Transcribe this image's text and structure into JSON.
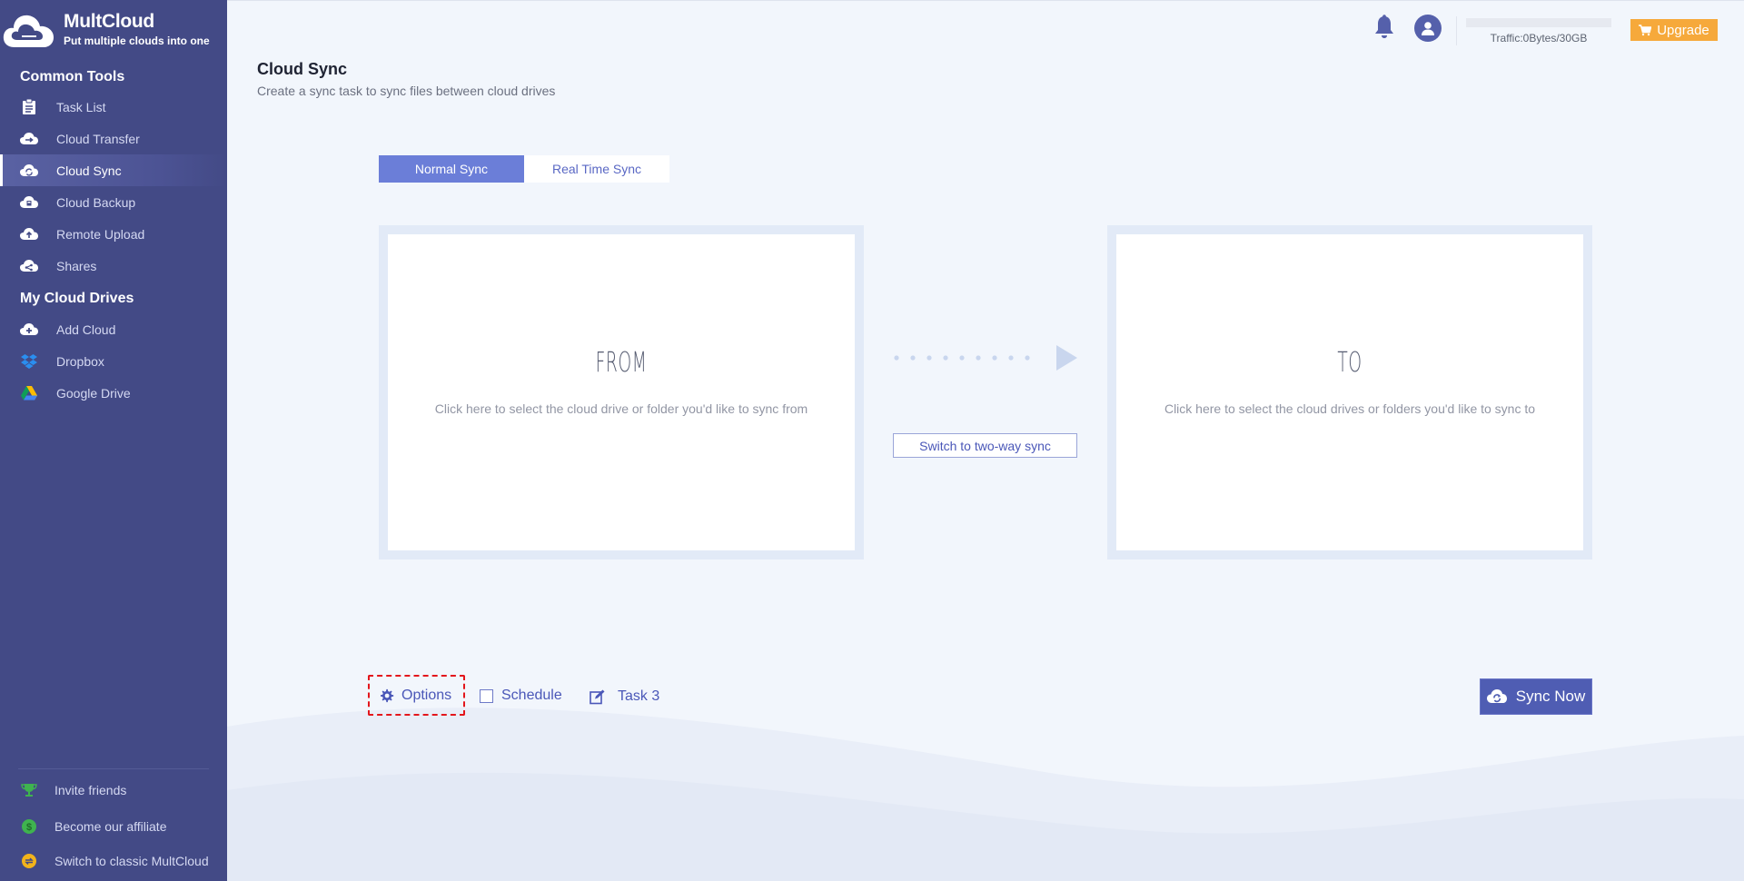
{
  "app": {
    "name": "MultCloud",
    "tagline": "Put multiple clouds into one"
  },
  "sidebar": {
    "common_tools_title": "Common Tools",
    "common_tools": [
      {
        "label": "Task List",
        "icon": "task-list-icon"
      },
      {
        "label": "Cloud Transfer",
        "icon": "cloud-transfer-icon"
      },
      {
        "label": "Cloud Sync",
        "icon": "cloud-sync-icon",
        "active": true
      },
      {
        "label": "Cloud Backup",
        "icon": "cloud-backup-icon"
      },
      {
        "label": "Remote Upload",
        "icon": "remote-upload-icon"
      },
      {
        "label": "Shares",
        "icon": "share-icon"
      }
    ],
    "my_cloud_drives_title": "My Cloud Drives",
    "my_cloud_drives": [
      {
        "label": "Add Cloud",
        "icon": "add-cloud-icon"
      },
      {
        "label": "Dropbox",
        "icon": "dropbox-icon"
      },
      {
        "label": "Google Drive",
        "icon": "google-drive-icon"
      }
    ],
    "bottom": [
      {
        "label": "Invite friends",
        "icon": "trophy-icon"
      },
      {
        "label": "Become our affiliate",
        "icon": "dollar-icon"
      },
      {
        "label": "Switch to classic MultCloud",
        "icon": "switch-icon"
      }
    ]
  },
  "header": {
    "traffic_label": "Traffic:0Bytes/30GB",
    "traffic_used_fraction": 0,
    "upgrade_label": "Upgrade"
  },
  "page": {
    "title": "Cloud Sync",
    "subtitle": "Create a sync task to sync files between cloud drives"
  },
  "tabs": [
    {
      "label": "Normal Sync",
      "active": true
    },
    {
      "label": "Real Time Sync",
      "active": false
    }
  ],
  "from_panel": {
    "heading": "FROM",
    "description": "Click here to select the cloud drive or folder you'd like to sync from"
  },
  "to_panel": {
    "heading": "TO",
    "description": "Click here to select the cloud drives or folders you'd like to sync to"
  },
  "switch_two_way_label": "Switch to two-way sync",
  "bottom_controls": {
    "options_label": "Options",
    "schedule_label": "Schedule",
    "schedule_checked": false,
    "task_name": "Task 3",
    "sync_now_label": "Sync Now"
  },
  "colors": {
    "sidebar_bg": "#434a86",
    "accent": "#4f5db3",
    "tab_active": "#6b7ed8",
    "upgrade": "#f6a93b",
    "highlight_box": "#e3161c"
  }
}
